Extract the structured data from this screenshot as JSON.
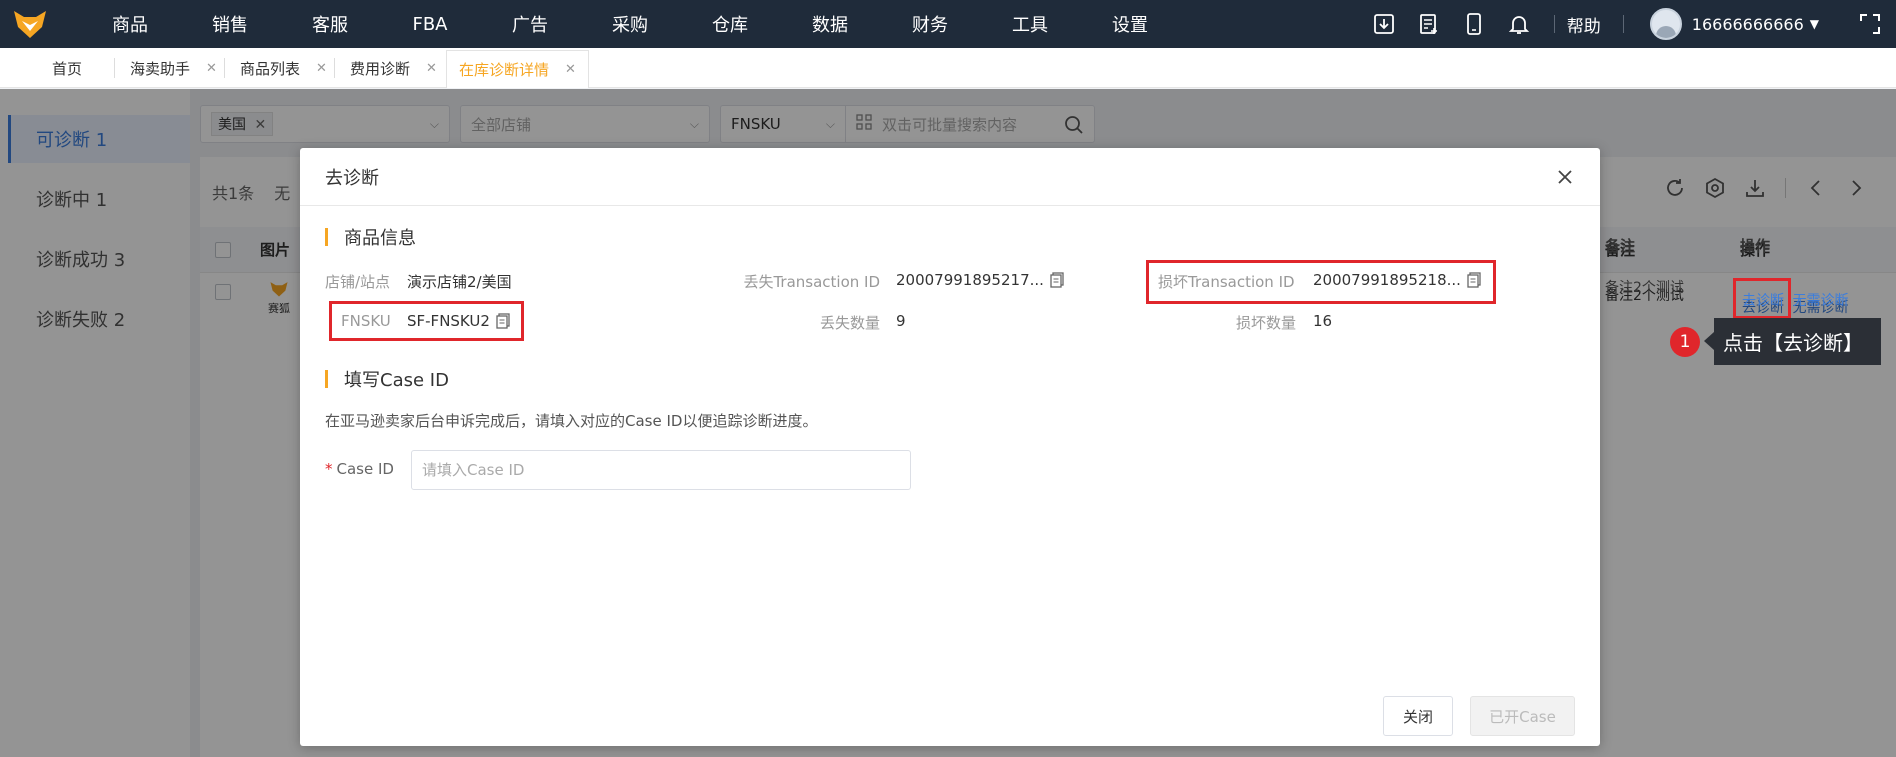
{
  "nav": {
    "items": [
      "商品",
      "销售",
      "客服",
      "FBA",
      "广告",
      "采购",
      "仓库",
      "数据",
      "财务",
      "工具",
      "设置"
    ],
    "help": "帮助",
    "user": "16666666666"
  },
  "tabs": [
    {
      "label": "首页"
    },
    {
      "label": "海卖助手"
    },
    {
      "label": "商品列表"
    },
    {
      "label": "费用诊断"
    },
    {
      "label": "在库诊断详情"
    }
  ],
  "sidebar": {
    "items": [
      {
        "label": "可诊断 1"
      },
      {
        "label": "诊断中 1"
      },
      {
        "label": "诊断成功 3"
      },
      {
        "label": "诊断失败 2"
      }
    ]
  },
  "filters": {
    "country_chip": "美国",
    "store_placeholder": "全部店铺",
    "search_type": "FNSKU",
    "search_placeholder": "双击可批量搜索内容"
  },
  "table": {
    "count": "共1条",
    "count_suffix": "无",
    "headers": {
      "image": "图片",
      "remark": "备注",
      "action": "操作"
    },
    "row": {
      "image_caption": "赛狐",
      "remark": "备注2个测试",
      "action_diagnose": "去诊断",
      "action_skip": "无需诊断"
    }
  },
  "modal": {
    "title": "去诊断",
    "section1": "商品信息",
    "section2": "填写Case ID",
    "fields": {
      "store_label": "店铺/站点",
      "store_value": "演示店铺2/美国",
      "lost_tid_label": "丢失Transaction ID",
      "lost_tid_value": "20007991895217...",
      "damaged_tid_label": "损坏Transaction ID",
      "damaged_tid_value": "20007991895218...",
      "fnsku_label": "FNSKU",
      "fnsku_value": "SF-FNSKU2",
      "lost_qty_label": "丢失数量",
      "lost_qty_value": "9",
      "damaged_qty_label": "损坏数量",
      "damaged_qty_value": "16"
    },
    "description": "在亚马逊卖家后台申诉完成后，请填入对应的Case ID以便追踪诊断进度。",
    "case_label": "Case ID",
    "case_placeholder": "请填入Case ID",
    "btn_close": "关闭",
    "btn_open": "已开Case"
  },
  "callout": {
    "number": "1",
    "text": "点击【去诊断】"
  },
  "colors": {
    "nav_bg": "#1f2b3a",
    "accent_orange": "#f6a623",
    "link_blue": "#3b7ddd",
    "highlight_red": "#e0262b"
  }
}
